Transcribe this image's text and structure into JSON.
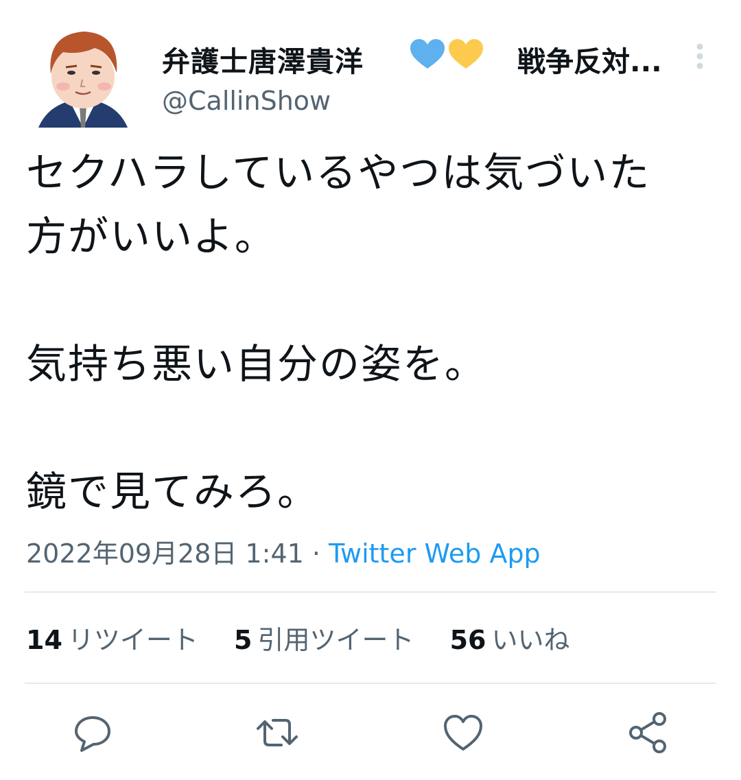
{
  "author": {
    "display_name": "弁護士唐澤貴洋",
    "name_suffix": "戦争反対...",
    "handle": "@CallinShow",
    "badges": [
      "blue-heart",
      "yellow-heart"
    ]
  },
  "tweet": {
    "text": "セクハラしているやつは気づいた\n方がいいよ。\n\n気持ち悪い自分の姿を。\n\n鏡で見てみろ。",
    "timestamp": "2022年09月28日 1:41",
    "separator": " · ",
    "source": "Twitter Web App"
  },
  "stats": [
    {
      "count": "14",
      "label": "リツイート"
    },
    {
      "count": "5",
      "label": "引用ツイート"
    },
    {
      "count": "56",
      "label": "いいね"
    }
  ],
  "actions": [
    "reply-icon",
    "retweet-icon",
    "like-icon",
    "share-icon"
  ],
  "colors": {
    "text": "#0f1419",
    "secondary": "#536471",
    "link": "#1d9bf0",
    "divider": "#e8e8e8",
    "blue_heart": "#5fb0ee",
    "yellow_heart": "#fccb4e"
  }
}
